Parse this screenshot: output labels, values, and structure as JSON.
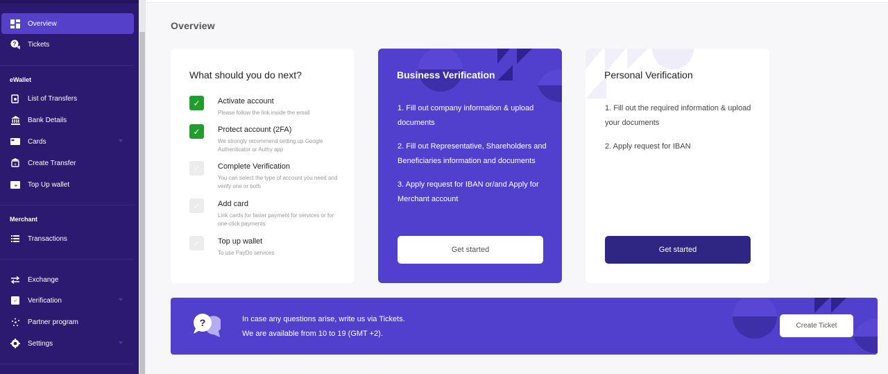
{
  "sidebar": {
    "items_top": [
      {
        "label": "Overview",
        "icon": "dashboard-icon",
        "active": true
      },
      {
        "label": "Tickets",
        "icon": "tickets-icon"
      }
    ],
    "section_ewallet": "eWallet",
    "items_ewallet": [
      {
        "label": "List of Transfers",
        "icon": "transfers-list-icon"
      },
      {
        "label": "Bank Details",
        "icon": "bank-icon"
      },
      {
        "label": "Cards",
        "icon": "card-icon",
        "has_submenu": true
      },
      {
        "label": "Create Transfer",
        "icon": "create-transfer-icon"
      },
      {
        "label": "Top Up wallet",
        "icon": "top-up-wallet-icon"
      }
    ],
    "section_merchant": "Merchant",
    "items_merchant": [
      {
        "label": "Transactions",
        "icon": "list-icon"
      }
    ],
    "items_bottom": [
      {
        "label": "Exchange",
        "icon": "exchange-arrows-icon"
      },
      {
        "label": "Verification",
        "icon": "verification-check-icon",
        "has_submenu": true
      },
      {
        "label": "Partner program",
        "icon": "partner-network-icon"
      },
      {
        "label": "Settings",
        "icon": "gear-icon",
        "has_submenu": true
      }
    ]
  },
  "main": {
    "page_title": "Overview",
    "next_steps": {
      "title": "What should you do next?",
      "tasks": [
        {
          "title": "Activate account",
          "desc": "Please follow the link inside the email",
          "done": true
        },
        {
          "title": "Protect account (2FA)",
          "desc": "We strongly recommend setting up Google Authenticator or Authy app",
          "done": true
        },
        {
          "title": "Complete Verification",
          "desc": "You can select the type of account you need and verify one or both",
          "done": false
        },
        {
          "title": "Add card",
          "desc": "Link cards for faster payment for services or for one-click payments",
          "done": false
        },
        {
          "title": "Top up wallet",
          "desc": "To use PayDo services",
          "done": false
        }
      ],
      "check_glyph": "✓"
    },
    "business": {
      "title": "Business Verification",
      "steps": [
        "1. Fill out company information & upload documents",
        "2. Fill out Representative, Shareholders and Beneficiaries information and documents",
        "3. Apply request for IBAN or/and Apply for Merchant account"
      ],
      "button": "Get started"
    },
    "personal": {
      "title": "Personal Verification",
      "steps": [
        "1. Fill out the required information & upload your documents",
        "2. Apply request for IBAN"
      ],
      "button": "Get started"
    },
    "support_banner": {
      "line1": "In case any questions arise, write us via Tickets.",
      "line2": "We are available from 10 to 19 (GMT +2).",
      "button": "Create Ticket"
    }
  },
  "colors": {
    "sidebar_bg": "#2b1a6f",
    "accent": "#5140cd",
    "active_item": "#5440c9",
    "done_check": "#1f9e2e",
    "dark_button": "#2e2682"
  }
}
